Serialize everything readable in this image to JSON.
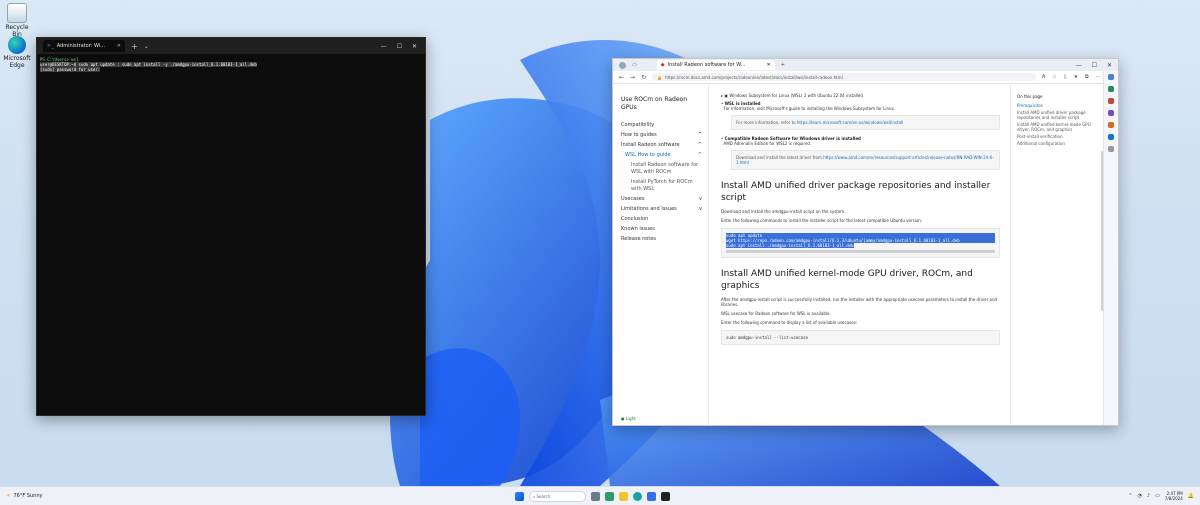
{
  "desktop": {
    "icons": [
      {
        "label": "Recycle Bin",
        "icon": "recycle-bin-icon"
      },
      {
        "label": "Microsoft Edge",
        "icon": "edge-icon"
      }
    ]
  },
  "terminal": {
    "tab_title": "Administrator: Wi...",
    "lines": [
      "PS C:\\Users> wsl",
      "user@DESKTOP:~$ sudo apt update ; sudo apt install -y ./amdgpu-install_6.1.60101-1_all.deb",
      "[sudo] password for user:"
    ]
  },
  "browser": {
    "tab_title": "Install Radeon software for W...",
    "url": "https://rocm.docs.amd.com/projects/radeon/en/latest/docs/install/wsl/install-radeon.html",
    "left_nav": {
      "title": "Use ROCm on Radeon GPUs",
      "items": [
        {
          "label": "Compatibility",
          "level": 0,
          "expander": ""
        },
        {
          "label": "How to guides",
          "level": 0,
          "expander": "^"
        },
        {
          "label": "Install Radeon software",
          "level": 0,
          "expander": "^"
        },
        {
          "label": "WSL How to guide",
          "level": 1,
          "expander": "^"
        },
        {
          "label": "Install Radeon software for WSL with ROCm",
          "level": 2,
          "expander": ""
        },
        {
          "label": "Install PyTorch for ROCm with WSL",
          "level": 2,
          "expander": ""
        },
        {
          "label": "Usecases",
          "level": 0,
          "expander": "v"
        },
        {
          "label": "Limitations and Issues",
          "level": 0,
          "expander": "v"
        },
        {
          "label": "Conclusion",
          "level": 0,
          "expander": ""
        },
        {
          "label": "Known issues",
          "level": 0,
          "expander": ""
        },
        {
          "label": "Release notes",
          "level": 0,
          "expander": ""
        }
      ],
      "footer": "Light"
    },
    "main": {
      "prereq_line": "Windows Subsystem for Linux (WSL) 2 with Ubuntu 22.04 installed",
      "bullets": [
        {
          "title": "WSL is installed",
          "text": "For information, visit Microsoft's guide to installing the Windows Subsystem for Linux."
        },
        {
          "title": "Compatible Radeon Software for Windows driver is installed",
          "text": "AMD Adrenalin Edition for WSL2 is required."
        }
      ],
      "note1": "For more information, refer to",
      "note1_link": "https://learn.microsoft.com/en-us/windows/wsl/install",
      "note2": "Download and install the latest driver from",
      "note2_link": "https://www.amd.com/en/resources/support-articles/release-notes/RN-RAD-WIN-24-6-1.html",
      "heading1": "Install AMD unified driver package repositories and installer script",
      "p1": "Download and install the amdgpu-install script on the system.",
      "p2": "Enter the following commands to install the installer script for the latest compatible Ubuntu version:",
      "code1": [
        "sudo apt update",
        "wget https://repo.radeon.com/amdgpu-install/6.1.3/ubuntu/jammy/amdgpu-install_6.1.60103-1_all.deb",
        "sudo apt install ./amdgpu-install_6.1.60103-1_all.deb"
      ],
      "heading2": "Install AMD unified kernel-mode GPU driver, ROCm, and graphics",
      "p3": "After the amdgpu-install script is successfully installed, run the installer with the appropriate usecase parameters to install the driver and libraries.",
      "p4": "WSL usecase for Radeon software for WSL is available.",
      "p5": "Enter the following command to display a list of available usecases:",
      "code2": "sudo amdgpu-install --list-usecase"
    },
    "toc": {
      "heading": "On this page",
      "entries": [
        {
          "label": "Prerequisites",
          "active": true
        },
        {
          "label": "Install AMD unified driver package repositories and installer script",
          "active": false
        },
        {
          "label": "Install AMD unified kernel-mode GPU driver, ROCm, and graphics",
          "active": false
        },
        {
          "label": "Post-install verification",
          "active": false
        },
        {
          "label": "Additional configuration",
          "active": false
        }
      ]
    }
  },
  "taskbar": {
    "weather": "76°F Sunny",
    "search_placeholder": "Search",
    "time": "2:47 PM",
    "date": "7/8/2024"
  },
  "colors": {
    "accent": "#0f6cbd",
    "bloom_dark": "#0a3bd8",
    "bloom_light": "#3d8bff"
  }
}
